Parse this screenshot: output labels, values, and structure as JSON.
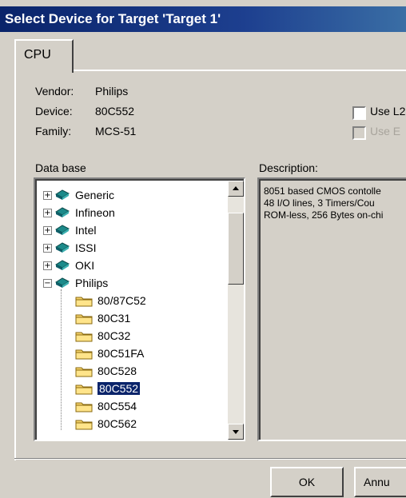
{
  "window": {
    "title": "Select Device for Target 'Target 1'"
  },
  "tabs": [
    {
      "label": "CPU"
    }
  ],
  "info": {
    "vendor_label": "Vendor:",
    "vendor_value": "Philips",
    "device_label": "Device:",
    "device_value": "80C552",
    "family_label": "Family:",
    "family_value": "MCS-51"
  },
  "options": {
    "use_l2_label": "Use L2",
    "use_l2_disabled_label": "Use E"
  },
  "database": {
    "label": "Data base",
    "vendors": [
      "Generic",
      "Infineon",
      "Intel",
      "ISSI",
      "OKI",
      "Philips"
    ],
    "philips_devices": [
      "80/87C52",
      "80C31",
      "80C32",
      "80C51FA",
      "80C528",
      "80C552",
      "80C554",
      "80C562"
    ],
    "selected_device": "80C552"
  },
  "description": {
    "label": "Description:",
    "lines": [
      "8051 based CMOS contolle",
      "48  I/O lines, 3 Timers/Cou",
      "ROM-less, 256 Bytes on-chi"
    ]
  },
  "buttons": {
    "ok": "OK",
    "cancel": "Annu"
  }
}
